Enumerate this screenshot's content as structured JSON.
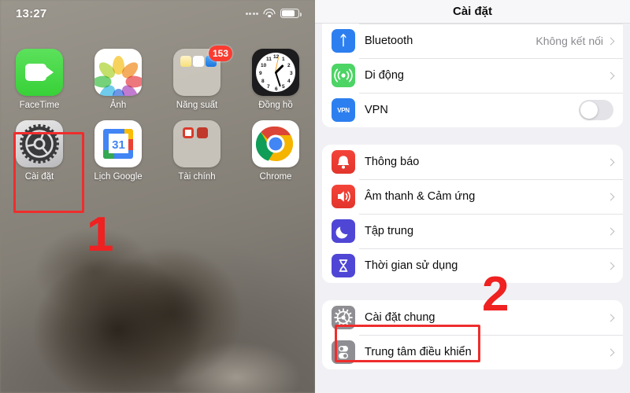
{
  "home": {
    "status_bar": {
      "time": "13:27",
      "wifi_icon": "wifi-icon",
      "battery_icon": "battery-icon",
      "signal_icon": "signal-dots-icon"
    },
    "apps_row1": [
      {
        "label": "FaceTime",
        "icon": "facetime-icon",
        "badge": null
      },
      {
        "label": "Ảnh",
        "icon": "photos-icon",
        "badge": null
      },
      {
        "label": "Năng suất",
        "icon": "folder-icon",
        "badge": "153"
      },
      {
        "label": "Đồng hồ",
        "icon": "clock-icon",
        "badge": null
      }
    ],
    "apps_row2": [
      {
        "label": "Cài đặt",
        "icon": "settings-gear-icon",
        "badge": null,
        "highlighted": true
      },
      {
        "label": "Lịch Google",
        "icon": "google-calendar-icon",
        "badge": null
      },
      {
        "label": "Tài chính",
        "icon": "folder-icon",
        "badge": null
      },
      {
        "label": "Chrome",
        "icon": "chrome-icon",
        "badge": null
      }
    ],
    "calendar_day": "31",
    "annotation": "1"
  },
  "settings": {
    "title": "Cài đặt",
    "annotation": "2",
    "group1": [
      {
        "label": "Bluetooth",
        "icon": "bluetooth-icon",
        "value": "Không kết nối",
        "accessory": "chevron"
      },
      {
        "label": "Di động",
        "icon": "cellular-icon",
        "value": "",
        "accessory": "chevron"
      },
      {
        "label": "VPN",
        "icon": "vpn-icon",
        "value": "",
        "accessory": "toggle",
        "toggle_on": false
      }
    ],
    "group2": [
      {
        "label": "Thông báo",
        "icon": "notification-bell-icon",
        "value": "",
        "accessory": "chevron"
      },
      {
        "label": "Âm thanh & Cảm ứng",
        "icon": "sound-speaker-icon",
        "value": "",
        "accessory": "chevron"
      },
      {
        "label": "Tập trung",
        "icon": "focus-moon-icon",
        "value": "",
        "accessory": "chevron"
      },
      {
        "label": "Thời gian sử dụng",
        "icon": "screentime-hourglass-icon",
        "value": "",
        "accessory": "chevron"
      }
    ],
    "group3": [
      {
        "label": "Cài đặt chung",
        "icon": "general-gear-icon",
        "value": "",
        "accessory": "chevron",
        "highlighted": true
      },
      {
        "label": "Trung tâm điều khiển",
        "icon": "control-center-icon",
        "value": "",
        "accessory": "chevron"
      }
    ]
  },
  "colors": {
    "annotation_red": "#ef2121",
    "highlight_box": "#ef2d2d",
    "badge_red": "#fb3b30",
    "ios_blue": "#2d7ff0",
    "ios_green": "#4cd464",
    "ios_indigo": "#4f46d6",
    "ios_gray": "#8e8e93"
  }
}
